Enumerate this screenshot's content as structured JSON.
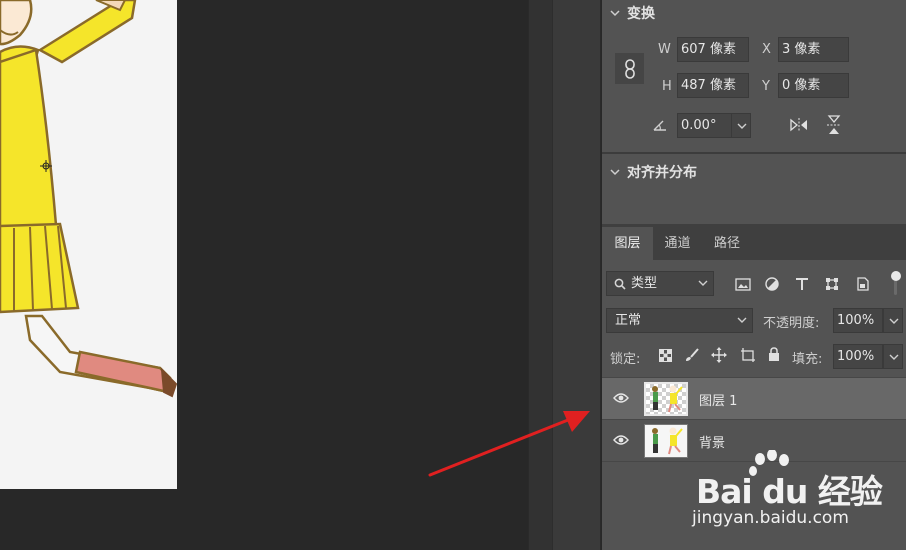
{
  "transform": {
    "title": "变换",
    "w_label": "W",
    "w_value": "607 像素",
    "x_label": "X",
    "x_value": "3 像素",
    "h_label": "H",
    "h_value": "487 像素",
    "y_label": "Y",
    "y_value": "0 像素",
    "angle_value": "0.00°"
  },
  "align": {
    "title": "对齐并分布"
  },
  "layers_panel": {
    "tabs": [
      {
        "label": "图层",
        "active": true
      },
      {
        "label": "通道",
        "active": false
      },
      {
        "label": "路径",
        "active": false
      }
    ],
    "filter_kind": "类型",
    "blend_mode": "正常",
    "opacity_label": "不透明度:",
    "opacity_value": "100%",
    "lock_label": "锁定:",
    "fill_label": "填充:",
    "fill_value": "100%",
    "layers": [
      {
        "name": "图层 1",
        "selected": true
      },
      {
        "name": "背景",
        "selected": false
      }
    ]
  },
  "watermark": {
    "logo": "Bai du 经验",
    "url": "jingyan.baidu.com"
  },
  "colors": {
    "panel_bg": "#535353",
    "canvas_bg": "#282828",
    "arrow": "#e02020",
    "character_yellow": "#f5e52a"
  }
}
